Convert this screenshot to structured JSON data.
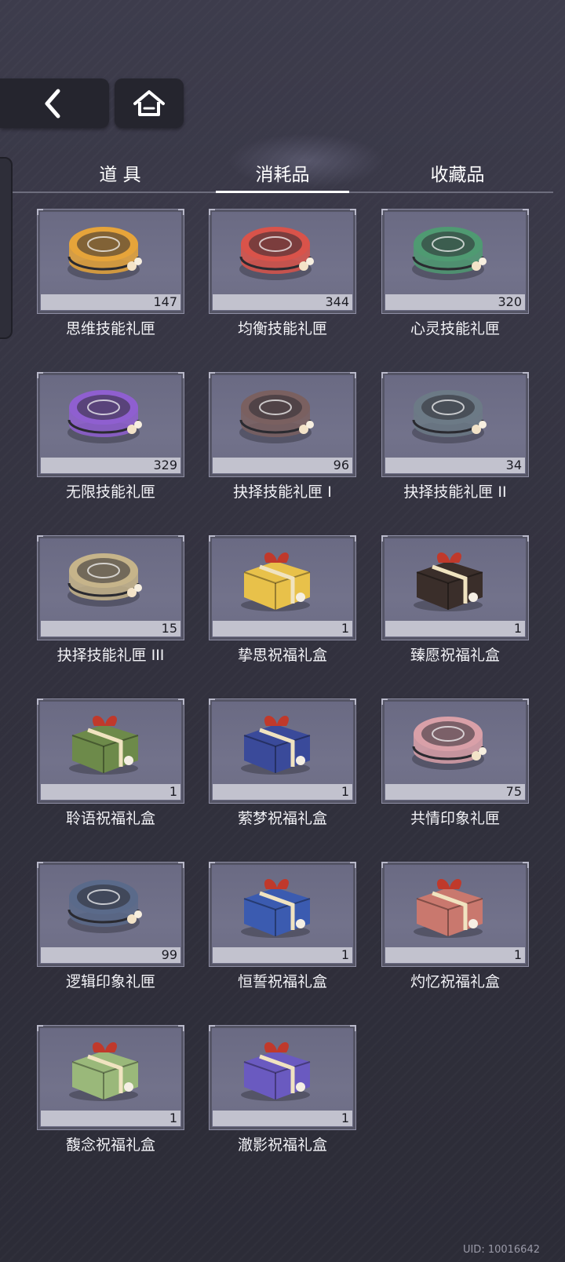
{
  "nav": {
    "back_icon": "chevron-left-icon",
    "home_icon": "home-icon"
  },
  "tabs": [
    {
      "label": "道 具",
      "active": false
    },
    {
      "label": "消耗品",
      "active": true
    },
    {
      "label": "收藏品",
      "active": false
    }
  ],
  "items": [
    {
      "name": "思维技能礼匣",
      "count": "147",
      "icon": "round-gift-case-icon",
      "color": "#e6a43a"
    },
    {
      "name": "均衡技能礼匣",
      "count": "344",
      "icon": "round-gift-case-icon",
      "color": "#d9534a"
    },
    {
      "name": "心灵技能礼匣",
      "count": "320",
      "icon": "round-gift-case-icon",
      "color": "#4f9a72"
    },
    {
      "name": "无限技能礼匣",
      "count": "329",
      "icon": "round-gift-case-icon",
      "color": "#8f5fd0"
    },
    {
      "name": "抉择技能礼匣 I",
      "count": "96",
      "icon": "round-gift-case-icon",
      "color": "#7a6060"
    },
    {
      "name": "抉择技能礼匣 II",
      "count": "34",
      "icon": "round-gift-case-icon",
      "color": "#6c7a86"
    },
    {
      "name": "抉择技能礼匣 III",
      "count": "15",
      "icon": "round-gift-case-icon",
      "color": "#c6b48a"
    },
    {
      "name": "挚思祝福礼盒",
      "count": "1",
      "icon": "gift-box-icon",
      "color": "#e8c14a"
    },
    {
      "name": "臻愿祝福礼盒",
      "count": "1",
      "icon": "gift-box-icon",
      "color": "#3a2e2a"
    },
    {
      "name": "聆语祝福礼盒",
      "count": "1",
      "icon": "gift-box-icon",
      "color": "#6d8a4a"
    },
    {
      "name": "萦梦祝福礼盒",
      "count": "1",
      "icon": "gift-box-icon",
      "color": "#3a4a9a"
    },
    {
      "name": "共情印象礼匣",
      "count": "75",
      "icon": "round-gift-case-icon",
      "color": "#d9a0a8"
    },
    {
      "name": "逻辑印象礼匣",
      "count": "99",
      "icon": "round-gift-case-icon",
      "color": "#5a6a8a"
    },
    {
      "name": "恒誓祝福礼盒",
      "count": "1",
      "icon": "gift-box-icon",
      "color": "#3b5bb0"
    },
    {
      "name": "灼忆祝福礼盒",
      "count": "1",
      "icon": "gift-box-icon",
      "color": "#c9786e"
    },
    {
      "name": "馥念祝福礼盒",
      "count": "1",
      "icon": "gift-box-icon",
      "color": "#9ab87a"
    },
    {
      "name": "澈影祝福礼盒",
      "count": "1",
      "icon": "gift-box-icon",
      "color": "#6a5ac0"
    }
  ],
  "footer": {
    "uid": "UID: 10016642"
  }
}
